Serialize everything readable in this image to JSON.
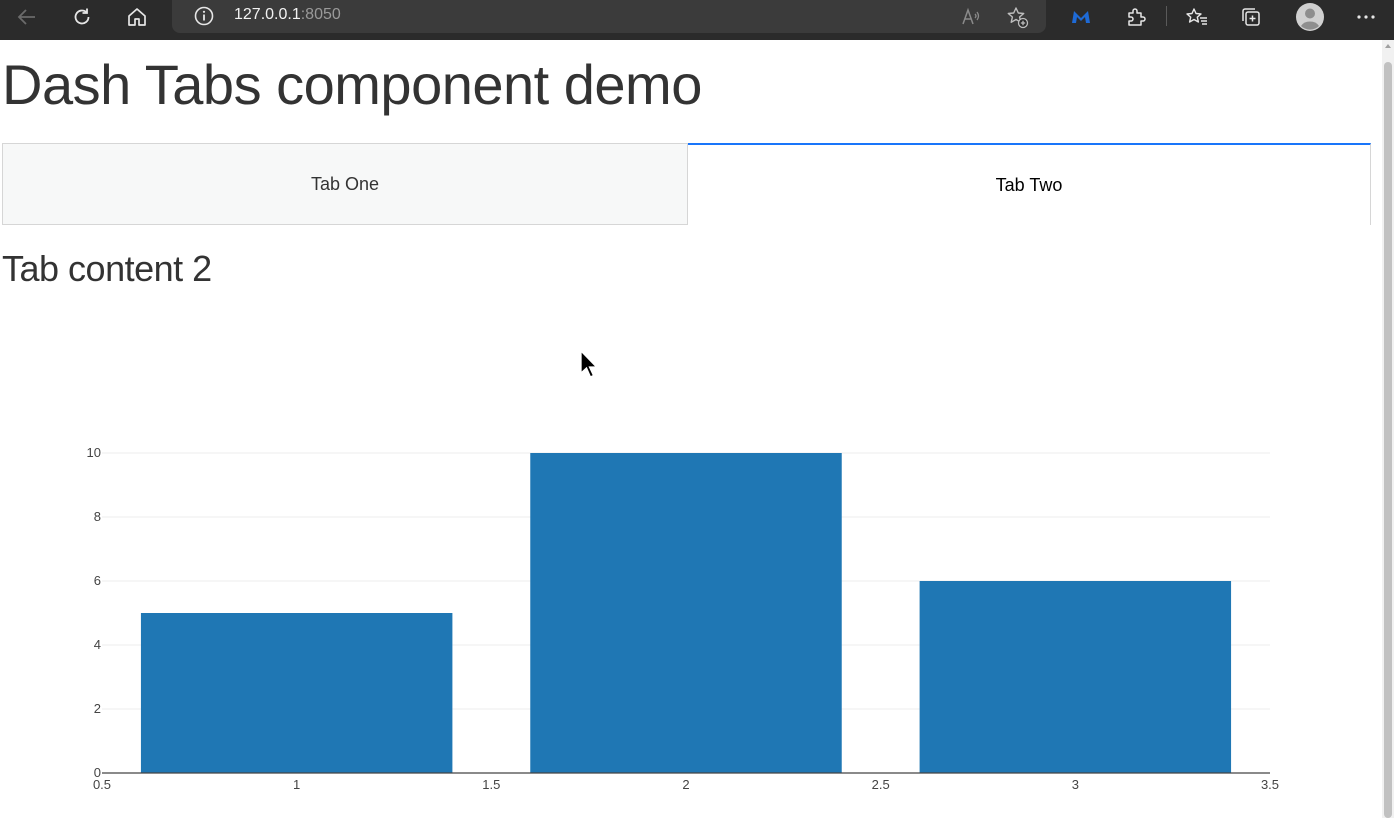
{
  "browser": {
    "url_host": "127.0.0.1",
    "url_port": ":8050"
  },
  "page": {
    "title": "Dash Tabs component demo",
    "tabs": [
      {
        "label": "Tab One",
        "selected": false
      },
      {
        "label": "Tab Two",
        "selected": true
      }
    ],
    "content_heading": "Tab content 2"
  },
  "colors": {
    "bar": "#1f77b4",
    "tab_selected_border": "#1975fa"
  },
  "chart_data": {
    "type": "bar",
    "x": [
      1,
      2,
      3
    ],
    "values": [
      5,
      10,
      6
    ],
    "bar_width": 0.8,
    "xlim": [
      0.5,
      3.5
    ],
    "ylim": [
      0,
      10
    ],
    "xticks": [
      "0.5",
      "1",
      "1.5",
      "2",
      "2.5",
      "3",
      "3.5"
    ],
    "yticks": [
      "0",
      "2",
      "4",
      "6",
      "8",
      "10"
    ],
    "grid": true,
    "title": "",
    "xlabel": "",
    "ylabel": ""
  }
}
